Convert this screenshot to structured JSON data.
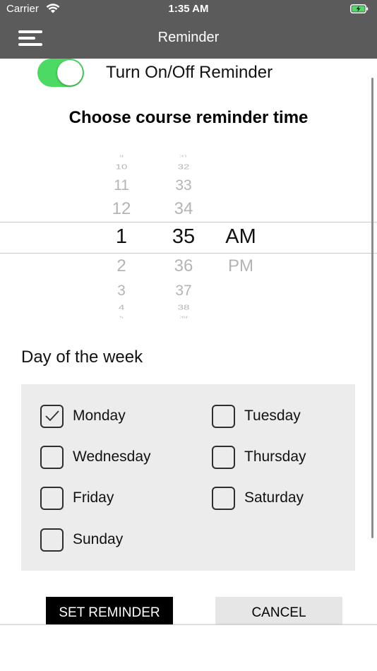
{
  "status": {
    "carrier": "Carrier",
    "time": "1:35 AM"
  },
  "nav": {
    "title": "Reminder"
  },
  "reminder": {
    "toggle_label": "Turn On/Off Reminder",
    "enabled": true
  },
  "section_title": "Choose course reminder time",
  "picker": {
    "hours": [
      "9",
      "10",
      "11",
      "12",
      "1",
      "2",
      "3",
      "4",
      "5"
    ],
    "minutes": [
      "31",
      "32",
      "33",
      "34",
      "35",
      "36",
      "37",
      "38",
      "39"
    ],
    "ampm": [
      "AM",
      "PM"
    ],
    "selected": {
      "hour": "1",
      "minute": "35",
      "period": "AM"
    }
  },
  "days_label": "Day of the week",
  "days": [
    {
      "label": "Monday",
      "checked": true
    },
    {
      "label": "Tuesday",
      "checked": false
    },
    {
      "label": "Wednesday",
      "checked": false
    },
    {
      "label": "Thursday",
      "checked": false
    },
    {
      "label": "Friday",
      "checked": false
    },
    {
      "label": "Saturday",
      "checked": false
    },
    {
      "label": "Sunday",
      "checked": false
    }
  ],
  "buttons": {
    "set": "SET REMINDER",
    "cancel": "CANCEL"
  },
  "colors": {
    "navbar": "#5b5b5b",
    "toggle_on": "#4cd964",
    "days_panel": "#ececec"
  }
}
